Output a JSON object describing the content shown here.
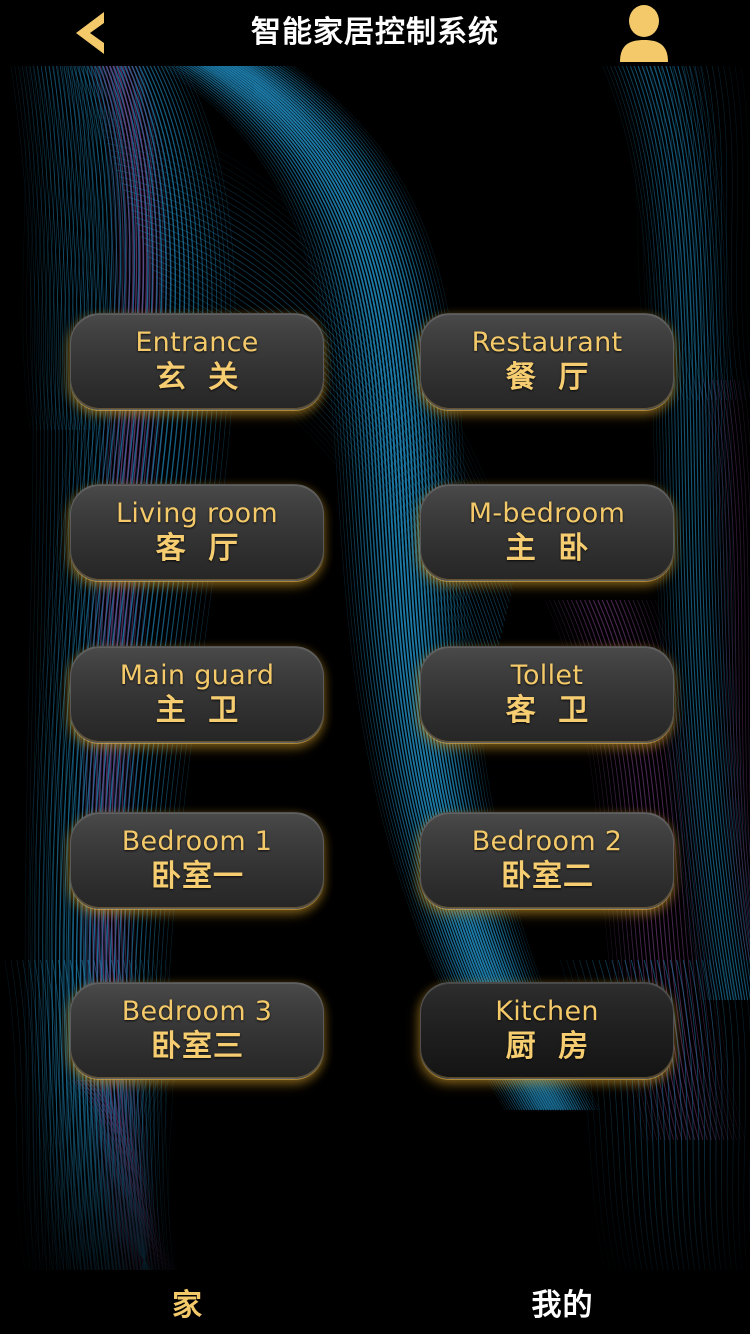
{
  "header": {
    "title": "智能家居控制系统",
    "back_icon": "chevron-left-icon",
    "avatar_icon": "user-avatar-icon",
    "accent_color": "#f3c96a",
    "title_color": "#ffffff"
  },
  "rooms": [
    {
      "en": "Entrance",
      "cn": "玄 关",
      "col": "left",
      "row": 1
    },
    {
      "en": "Restaurant",
      "cn": "餐 厅",
      "col": "right",
      "row": 1
    },
    {
      "en": "Living room",
      "cn": "客 厅",
      "col": "left",
      "row": 2
    },
    {
      "en": "M-bedroom",
      "cn": "主 卧",
      "col": "right",
      "row": 2
    },
    {
      "en": "Main guard",
      "cn": "主 卫",
      "col": "left",
      "row": 3
    },
    {
      "en": "Tollet",
      "cn": "客 卫",
      "col": "right",
      "row": 3
    },
    {
      "en": "Bedroom 1",
      "cn": "卧室一",
      "col": "left",
      "row": 4
    },
    {
      "en": "Bedroom 2",
      "cn": "卧室二",
      "col": "right",
      "row": 4
    },
    {
      "en": "Bedroom 3",
      "cn": "卧室三",
      "col": "left",
      "row": 5
    },
    {
      "en": "Kitchen",
      "cn": "厨 房",
      "col": "right",
      "row": 5
    }
  ],
  "tabbar": {
    "items": [
      {
        "label": "家",
        "active": true
      },
      {
        "label": "我的",
        "active": false
      }
    ],
    "active_color": "#f3c96a",
    "inactive_color": "#ffffff"
  },
  "theme": {
    "background": "#000000",
    "button_gold": "#f3c96a",
    "line_teal": "#1f86b8",
    "line_purple": "#7a3f86"
  }
}
